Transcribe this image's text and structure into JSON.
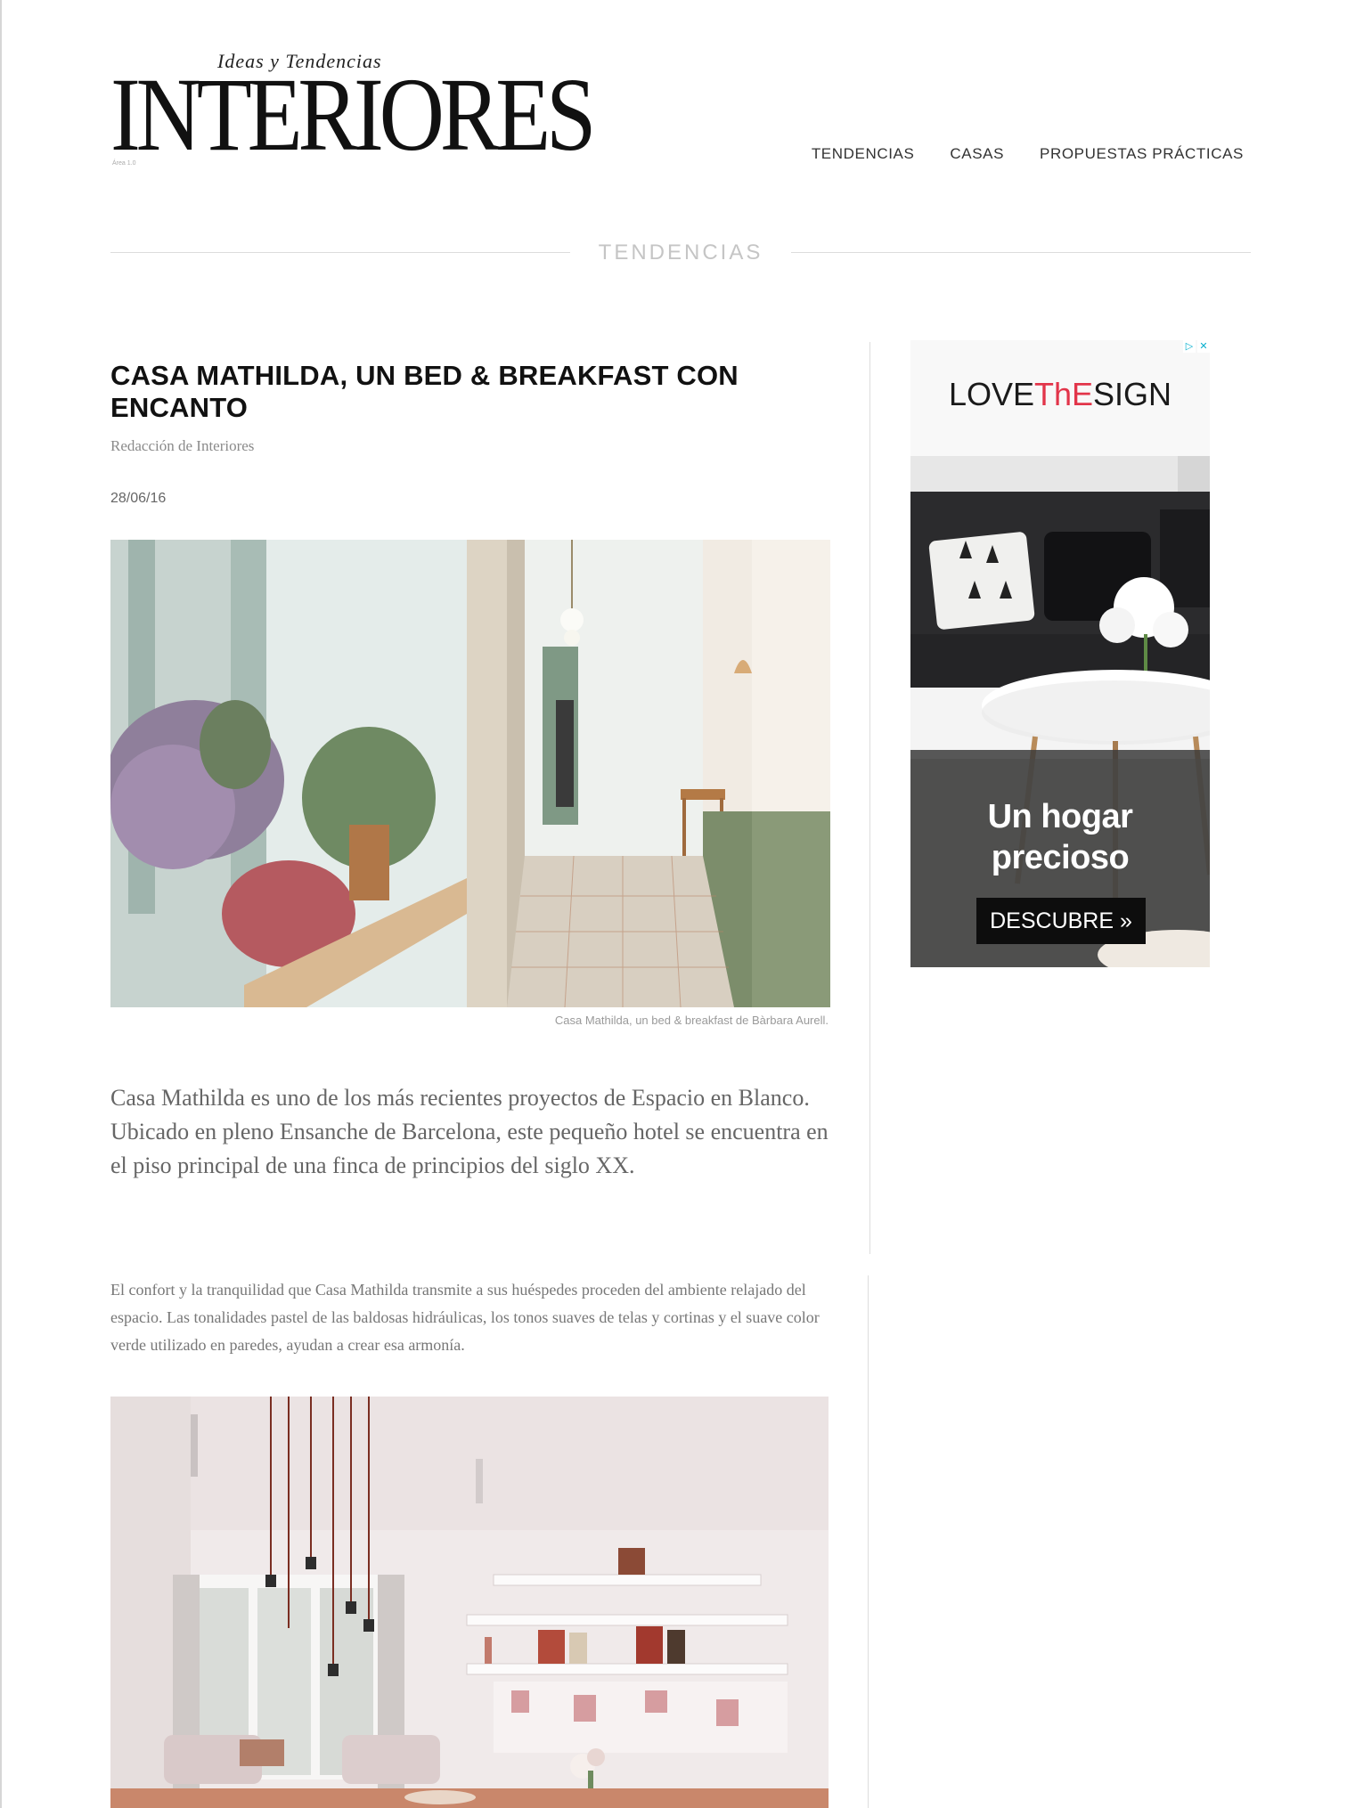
{
  "site": {
    "logo_script": "Ideas y Tendencias",
    "logo_main": "INTERIORES",
    "logo_tiny": "Área 1.0"
  },
  "nav": {
    "items": [
      {
        "label": "TENDENCIAS"
      },
      {
        "label": "CASAS"
      },
      {
        "label": "PROPUESTAS PRÁCTICAS"
      }
    ]
  },
  "section": {
    "label": "TENDENCIAS"
  },
  "article": {
    "title": "CASA MATHILDA, UN BED & BREAKFAST CON ENCANTO",
    "byline": "Redacción de Interiores",
    "date": "28/06/16",
    "photo1_caption": "Casa Mathilda, un bed & breakfast de Bàrbara Aurell.",
    "lead": "Casa Mathilda es uno de los más recientes proyectos de Espacio en Blanco. Ubicado en pleno Ensanche de Barcelona, este pequeño hotel se encuentra en el piso principal de una finca de principios del siglo XX.",
    "body": "El confort y la tranquilidad que Casa Mathilda transmite a sus huéspedes proceden del ambiente relajado del espacio. Las tonalidades pastel de las baldosas hidráulicas, los tonos suaves de telas y cortinas y el suave color verde utilizado en paredes, ayudan a crear esa armonía."
  },
  "ad": {
    "badge_icons": [
      "adchoices-icon",
      "close-icon"
    ],
    "brand_parts": {
      "a": "LOVE",
      "b": "ThE",
      "c": "SIGN"
    },
    "headline_1": "Un hogar",
    "headline_2": "precioso",
    "cta": "DESCUBRE »",
    "colors": {
      "brand_red": "#e2354a",
      "cta_bg": "#0d0d0d"
    }
  }
}
